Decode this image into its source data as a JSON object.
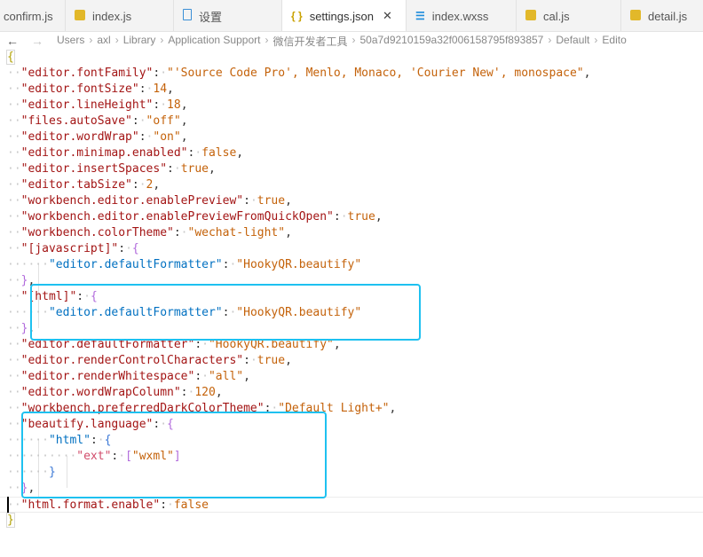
{
  "tabs": [
    {
      "label": "confirm.js",
      "icon": "js-file-icon"
    },
    {
      "label": "index.js",
      "icon": "js-file-icon"
    },
    {
      "label": "设置",
      "icon": "document-icon"
    },
    {
      "label": "settings.json",
      "icon": "json-file-icon",
      "close": "✕"
    },
    {
      "label": "index.wxss",
      "icon": "css-file-icon"
    },
    {
      "label": "cal.js",
      "icon": "js-file-icon"
    },
    {
      "label": "detail.js",
      "icon": "js-file-icon"
    }
  ],
  "nav": {
    "back": "←",
    "forward": "→"
  },
  "breadcrumb": [
    "Users",
    "axl",
    "Library",
    "Application Support",
    "微信开发者工具",
    "50a7d9210159a32f006158795f893857",
    "Default",
    "Edito"
  ],
  "breadcrumb_sep": "›",
  "code": {
    "open_brace": "{",
    "close_brace": "}",
    "font_family_key": "\"editor.fontFamily\"",
    "font_family_val": "\"'Source Code Pro', Menlo, Monaco, 'Courier New', monospace\"",
    "font_size_key": "\"editor.fontSize\"",
    "font_size_val": "14",
    "line_height_key": "\"editor.lineHeight\"",
    "line_height_val": "18",
    "autosave_key": "\"files.autoSave\"",
    "autosave_val": "\"off\"",
    "wordwrap_key": "\"editor.wordWrap\"",
    "wordwrap_val": "\"on\"",
    "minimap_key": "\"editor.minimap.enabled\"",
    "minimap_val": "false",
    "insertspaces_key": "\"editor.insertSpaces\"",
    "insertspaces_val": "true",
    "tabsize_key": "\"editor.tabSize\"",
    "tabsize_val": "2",
    "preview_key": "\"workbench.editor.enablePreview\"",
    "preview_val": "true",
    "preview_qo_key": "\"workbench.editor.enablePreviewFromQuickOpen\"",
    "preview_qo_val": "true",
    "theme_key": "\"workbench.colorTheme\"",
    "theme_val": "\"wechat-light\"",
    "js_key": "\"[javascript]\"",
    "js_fmt_key": "\"editor.defaultFormatter\"",
    "js_fmt_val": "\"HookyQR.beautify\"",
    "html_key": "\"[html]\"",
    "html_fmt_key": "\"editor.defaultFormatter\"",
    "html_fmt_val": "\"HookyQR.beautify\"",
    "def_fmt_key": "\"editor.defaultFormatter\"",
    "def_fmt_val": "\"HookyQR.beautify\"",
    "render_ctrl_key": "\"editor.renderControlCharacters\"",
    "render_ctrl_val": "true",
    "render_ws_key": "\"editor.renderWhitespace\"",
    "render_ws_val": "\"all\"",
    "wrap_col_key": "\"editor.wordWrapColumn\"",
    "wrap_col_val": "120",
    "dark_theme_key": "\"workbench.preferredDarkColorTheme\"",
    "dark_theme_val": "\"Default Light+\"",
    "beautify_key": "\"beautify.language\"",
    "bhtml_key": "\"html\"",
    "ext_key": "\"ext\"",
    "ext_val": "\"wxml\"",
    "html_format_key": "\"html.format.enable\"",
    "html_format_val": "false"
  },
  "colors": {
    "highlight_box": "#1ec1f0",
    "active_tab": "#ffffff",
    "tabbar": "#f3f3f3"
  }
}
